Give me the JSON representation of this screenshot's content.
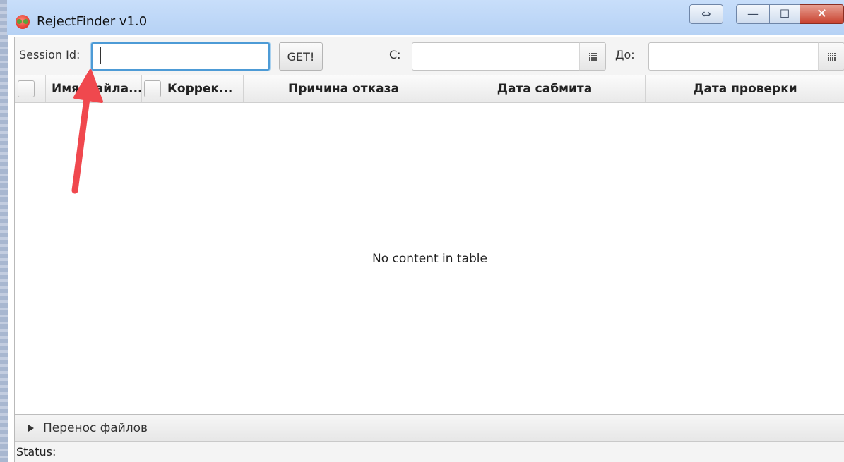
{
  "window": {
    "title": "RejectFinder v1.0",
    "extra_btn_glyph": "⇔",
    "min_glyph": "—",
    "max_glyph": "☐",
    "close_glyph": "✕"
  },
  "toolbar": {
    "session_label": "Session Id:",
    "session_value": "",
    "get_button": "GET!",
    "from_label": "С:",
    "from_value": "",
    "to_label": "До:",
    "to_value": ""
  },
  "table": {
    "columns": [
      "Имя файла...",
      "Коррек...",
      "Причина отказа",
      "Дата сабмита",
      "Дата проверки"
    ],
    "columns_visible": [
      "Имя файла...",
      "Коррек...",
      "Причина отказа",
      "Дата сабмита",
      "Дата проверки"
    ],
    "empty_message": "No content in table"
  },
  "titled_pane": {
    "label": "Перенос файлов",
    "expanded": false
  },
  "status": {
    "label": "Status:"
  },
  "colors": {
    "titlebar": "#c8defa",
    "focus_ring": "#4d9bd6",
    "close_button": "#c8412e",
    "annotation_arrow": "#f0484e"
  },
  "icons": [
    "app-logo-icon",
    "calendar-icon",
    "calendar-icon",
    "expand-triangle-icon"
  ]
}
